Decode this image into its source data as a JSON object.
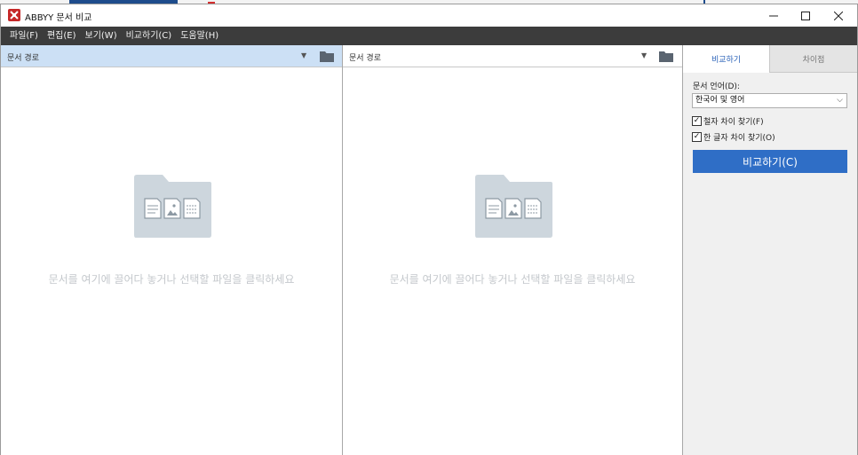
{
  "window": {
    "title": "ABBYY 문서 비교"
  },
  "menu": {
    "items": [
      "파일(F)",
      "편집(E)",
      "보기(W)",
      "비교하기(C)",
      "도움말(H)"
    ]
  },
  "left_pane": {
    "path_label": "문서 경로",
    "drop_hint": "문서를 여기에 끌어다 놓거나 선택할 파일을 클릭하세요"
  },
  "right_pane": {
    "path_label": "문서 경로",
    "drop_hint": "문서를 여기에 끌어다 놓거나 선택할 파일을 클릭하세요"
  },
  "panel": {
    "tabs": [
      "비교하기",
      "차이점"
    ],
    "active_tab": "비교하기",
    "language_label": "문서 언어(D):",
    "language_value": "한국어 및 영어",
    "options": [
      {
        "label": "철자 차이 찾기(F)",
        "checked": true
      },
      {
        "label": "한 글자 차이 찾기(O)",
        "checked": true
      }
    ],
    "compare_button": "비교하기(C)"
  },
  "colors": {
    "menubar": "#3c3c3c",
    "accent": "#2f6ec6",
    "selected_path": "#cce0f5",
    "illustration": "#cdd6dd"
  }
}
